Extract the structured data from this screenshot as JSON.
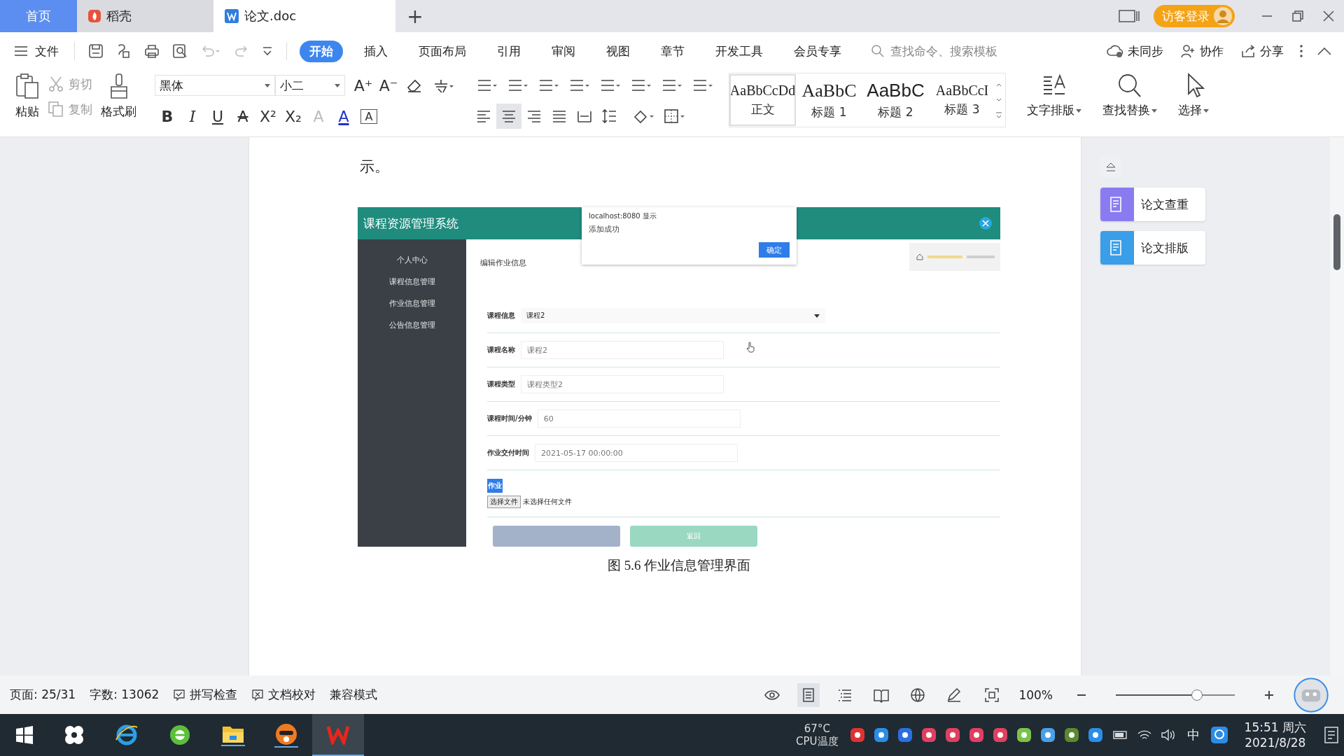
{
  "tabs": [
    {
      "label": "首页",
      "kind": "home",
      "selected": false
    },
    {
      "label": "稻壳",
      "kind": "docer",
      "selected": false
    },
    {
      "label": "论文.doc",
      "kind": "doc",
      "selected": true
    }
  ],
  "new_tab": "+",
  "login": "访客登录",
  "menu": {
    "file": "文件",
    "ribbon_tabs": [
      {
        "label": "开始",
        "selected": true
      },
      {
        "label": "插入",
        "selected": false
      },
      {
        "label": "页面布局",
        "selected": false
      },
      {
        "label": "引用",
        "selected": false
      },
      {
        "label": "审阅",
        "selected": false
      },
      {
        "label": "视图",
        "selected": false
      },
      {
        "label": "章节",
        "selected": false
      },
      {
        "label": "开发工具",
        "selected": false
      },
      {
        "label": "会员专享",
        "selected": false
      }
    ],
    "search": {
      "placeholder": "查找命令、搜索模板"
    },
    "actions": [
      {
        "label": "未同步",
        "kind": "cloud"
      },
      {
        "label": "协作",
        "kind": "person"
      },
      {
        "label": "分享",
        "kind": "share"
      }
    ]
  },
  "ribbon": {
    "paste": "粘贴",
    "cut": "剪切",
    "copy": "复制",
    "format_painter": "格式刷",
    "font": "黑体",
    "size": "小二",
    "size_tools": [
      "A⁺",
      "A⁻"
    ],
    "font_tools": [
      {
        "glyph": "B",
        "kind": "bold"
      },
      {
        "glyph": "I",
        "kind": "italic"
      },
      {
        "glyph": "U",
        "kind": "underline"
      },
      {
        "glyph": "A",
        "kind": "strike"
      },
      {
        "glyph": "X²",
        "kind": "plain"
      },
      {
        "glyph": "X₂",
        "kind": "plain"
      },
      {
        "glyph": "A",
        "kind": "faded"
      },
      {
        "glyph": "A",
        "kind": "color"
      },
      {
        "glyph": "A",
        "kind": "boxed"
      }
    ],
    "align": [
      {
        "kind": "left",
        "selected": false
      },
      {
        "kind": "center",
        "selected": true
      },
      {
        "kind": "right",
        "selected": false
      },
      {
        "kind": "justify",
        "selected": false
      },
      {
        "kind": "distribute",
        "selected": false
      }
    ],
    "styles": [
      {
        "preview": "AaBbCcDd",
        "label": "正文",
        "selected": true
      },
      {
        "preview": "AaBbC",
        "label": "标题 1",
        "selected": false
      },
      {
        "preview": "AaBbC",
        "label": "标题 2",
        "selected": false
      },
      {
        "preview": "AaBbCcI",
        "label": "标题 3",
        "selected": false
      }
    ],
    "tools": [
      {
        "label": "文字排版",
        "kind": "layout"
      },
      {
        "label": "查找替换",
        "kind": "find"
      },
      {
        "label": "选择",
        "kind": "select"
      }
    ]
  },
  "document": {
    "lead_text": "示。",
    "figure": {
      "app_title": "课程资源管理系统",
      "sidebar": [
        "个人中心",
        "课程信息管理",
        "作业信息管理",
        "公告信息管理"
      ],
      "page_title": "编辑作业信息",
      "dialog": {
        "title": "localhost:8080 显示",
        "message": "添加成功",
        "button": "确定"
      },
      "rows": [
        {
          "label": "课程信息",
          "value": "课程2",
          "kind": "select"
        },
        {
          "label": "课程名称",
          "value": "课程2",
          "kind": "input"
        },
        {
          "label": "课程类型",
          "value": "课程类型2",
          "kind": "input"
        },
        {
          "label": "课程时间/分钟",
          "value": "60",
          "kind": "input"
        },
        {
          "label": "作业交付时间",
          "value": "2021-05-17 00:00:00",
          "kind": "input"
        }
      ],
      "upload": {
        "label": "作业",
        "button": "选择文件",
        "status": "未选择任何文件"
      },
      "back_button": "返回"
    },
    "caption": "图 5.6  作业信息管理界面"
  },
  "side_panel": [
    {
      "label": "论文查重",
      "color": "#8a7cf0"
    },
    {
      "label": "论文排版",
      "color": "#3a9ee8"
    }
  ],
  "status_bar": {
    "page": "页面: 25/31",
    "words": "字数: 13062",
    "spell": "拼写检查",
    "proof": "文档校对",
    "mode": "兼容模式",
    "zoom": "100%",
    "zoom_slider": {
      "level": 0.68
    },
    "views": [
      {
        "kind": "eye",
        "selected": false
      },
      {
        "kind": "page",
        "selected": true
      },
      {
        "kind": "outline",
        "selected": false
      },
      {
        "kind": "book",
        "selected": false
      },
      {
        "kind": "web",
        "selected": false
      },
      {
        "kind": "pen",
        "selected": false
      }
    ]
  },
  "taskbar": {
    "temp": "67°C",
    "temp_label": "CPU温度",
    "ime": "中",
    "time": "15:51 周六",
    "date": "2021/8/28"
  }
}
